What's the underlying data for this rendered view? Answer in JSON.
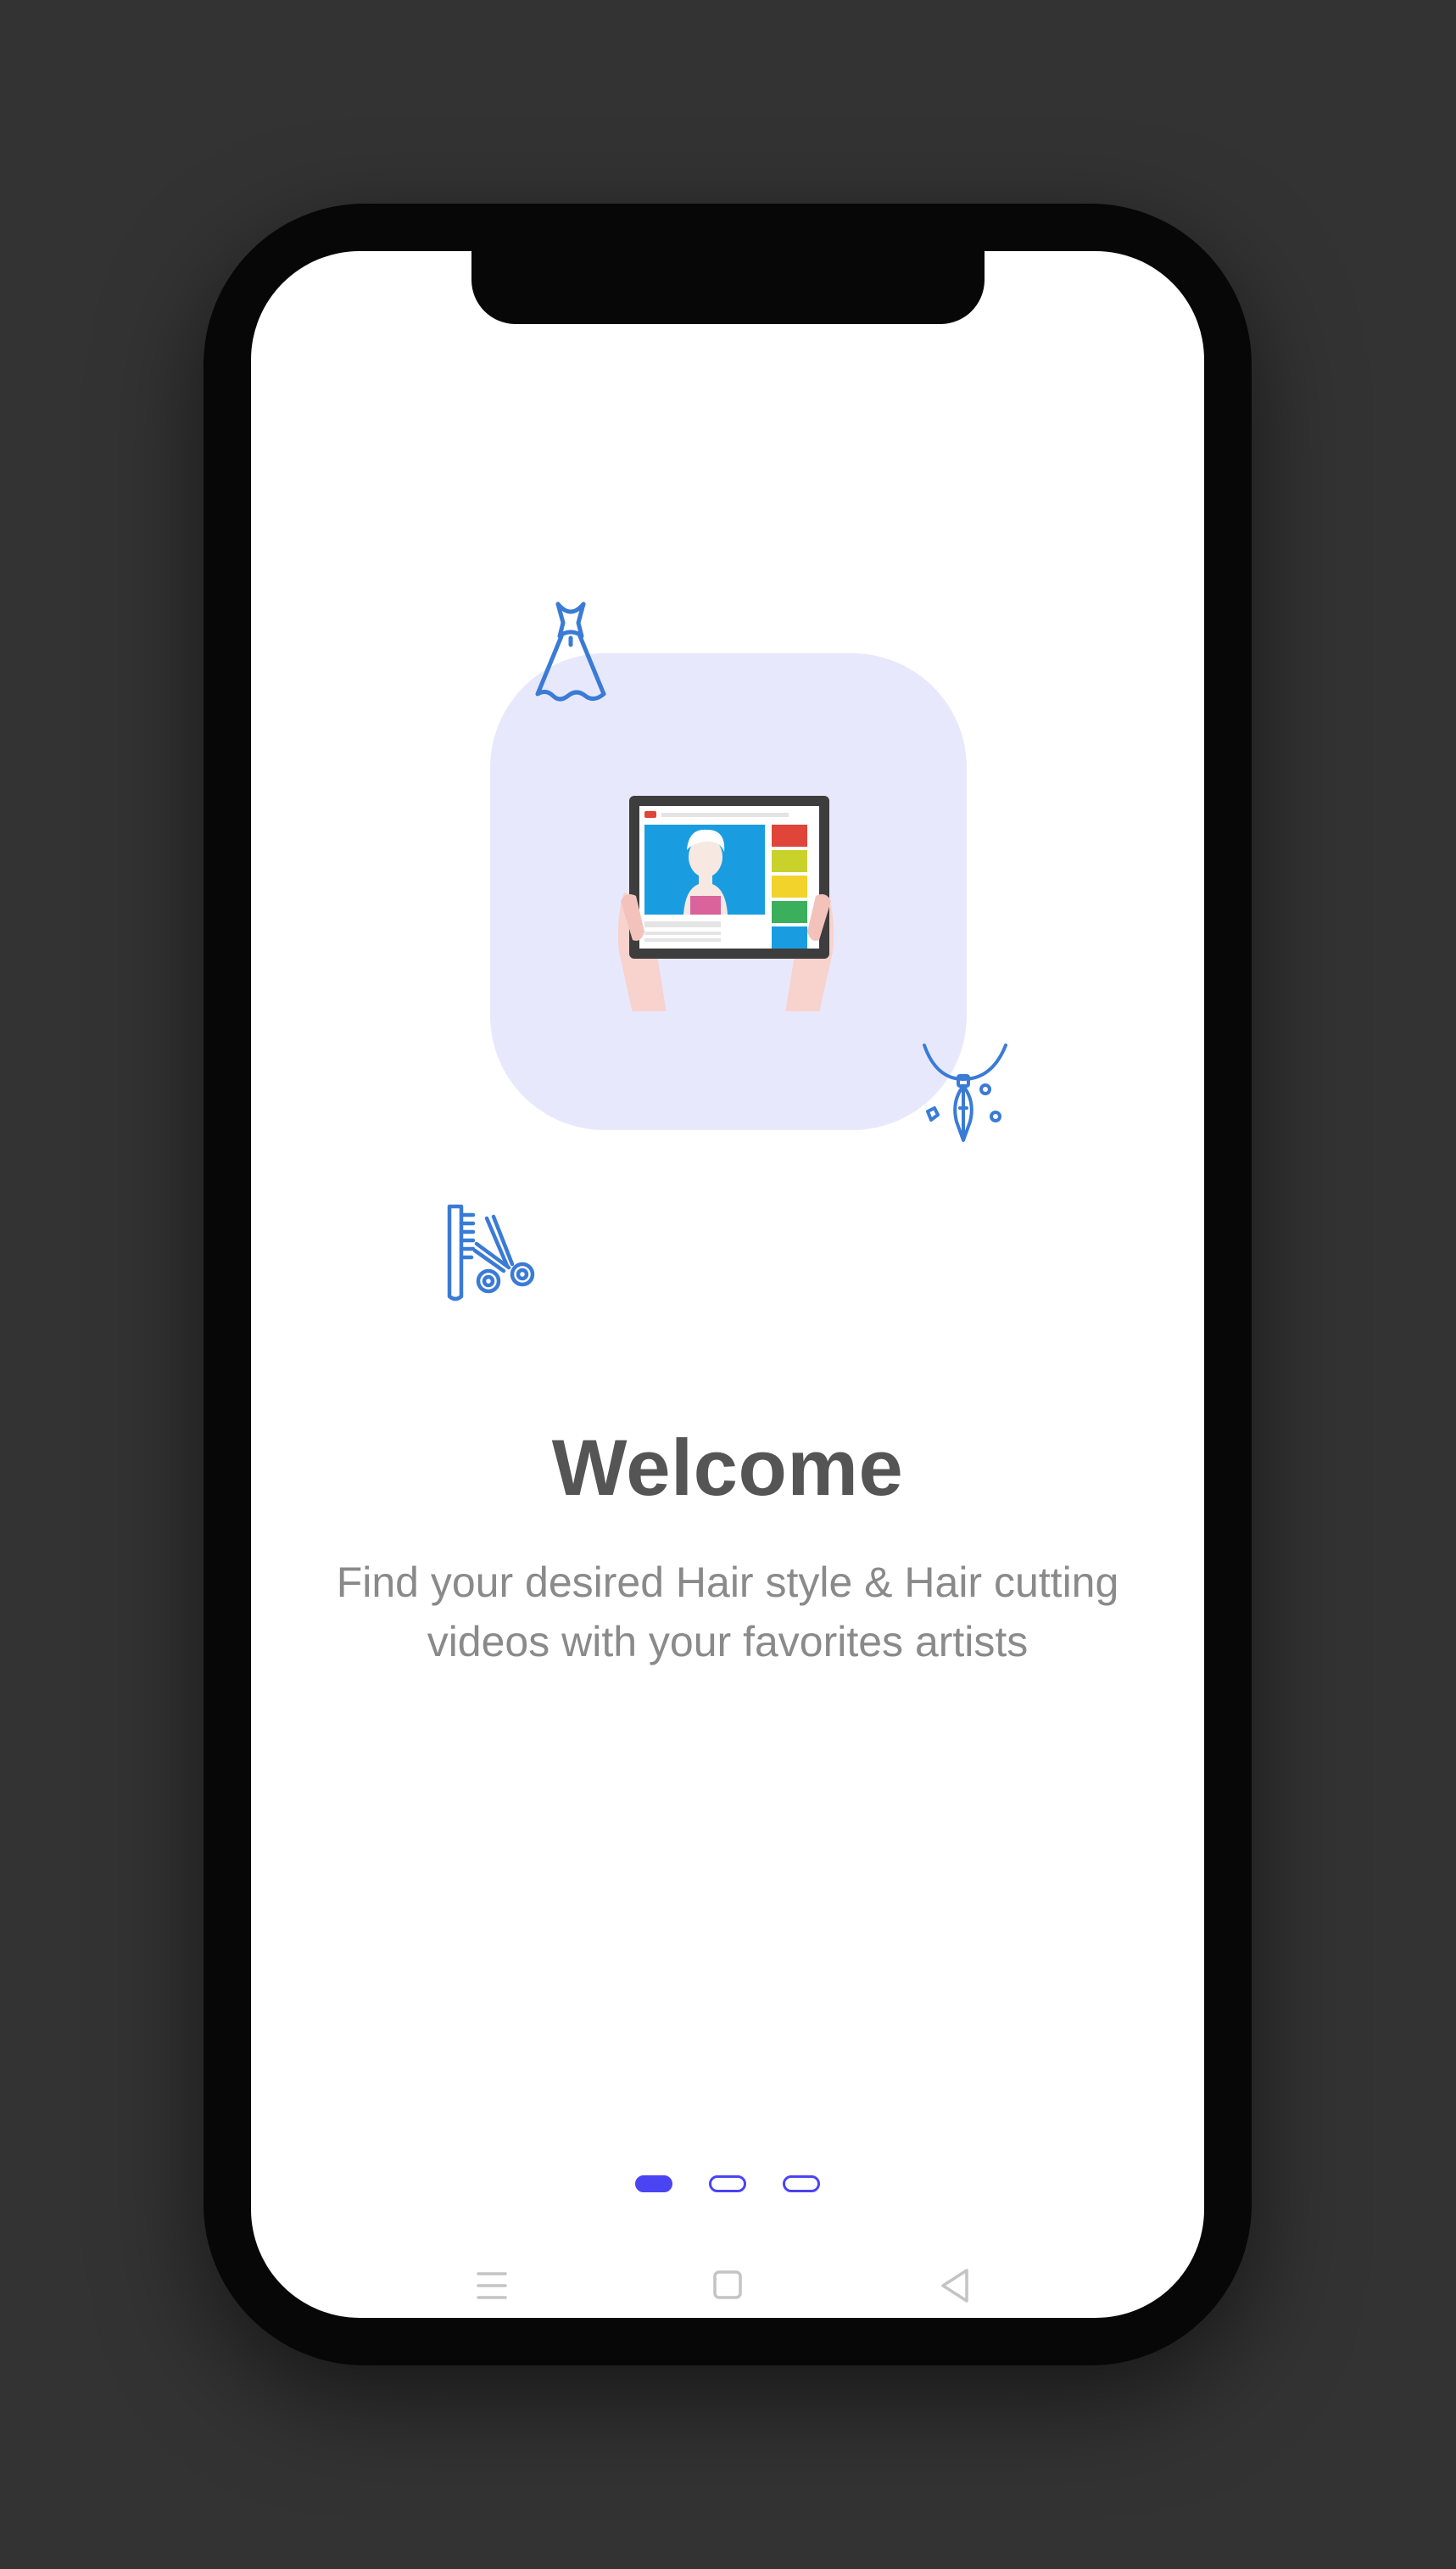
{
  "onboarding": {
    "title": "Welcome",
    "subtitle": "Find your desired Hair style & Hair cutting videos with your favorites artists"
  },
  "pager": {
    "total_pages": 3,
    "active_page": 1
  },
  "navigation": {
    "buttons": [
      {
        "icon": "menu-icon"
      },
      {
        "icon": "home-square-icon"
      },
      {
        "icon": "back-triangle-icon"
      }
    ]
  },
  "colors": {
    "accent": "#4a44f2",
    "hero_background": "#e8e8fd",
    "icon_blue": "#3a7bd5",
    "title_text": "#555555",
    "subtitle_text": "#8a8a8a",
    "page_background": "#333333",
    "phone_frame": "#070707"
  },
  "icons": {
    "dress": "dress-icon",
    "necklace": "necklace-icon",
    "comb_scissors": "comb-scissors-icon",
    "tablet_video": "tablet-video-illustration"
  }
}
